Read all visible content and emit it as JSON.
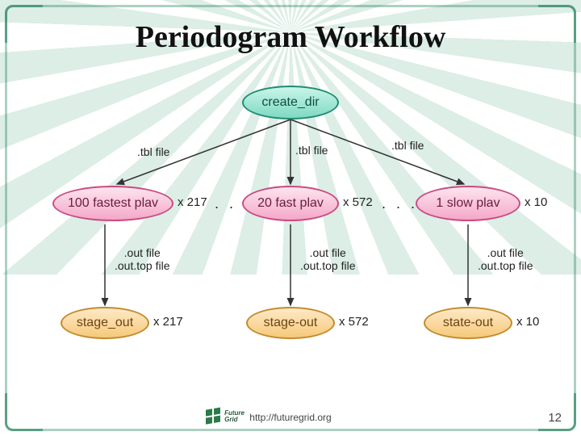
{
  "title": "Periodogram Workflow",
  "footer_url": "http://futuregrid.org",
  "page_number": "12",
  "logo_text": "Future\nGrid",
  "nodes": {
    "root": "create_dir",
    "fastest": "100 fastest plav",
    "fast": "20 fast plav",
    "slow": "1 slow plav",
    "stage_left": "stage_out",
    "stage_mid": "stage-out",
    "stage_right": "state-out"
  },
  "edge_labels": {
    "tbl_left": ".tbl file",
    "tbl_mid": ".tbl file",
    "tbl_right": ".tbl file",
    "out_left": ".out file\n.out.top file",
    "out_mid": ".out file\n.out.top file",
    "out_right": ".out file\n.out.top file"
  },
  "multipliers": {
    "fastest": "x 217",
    "fast": "x 572",
    "slow": "x 10",
    "stage_left": "x 217",
    "stage_mid": "x 572",
    "stage_right": "x 10"
  },
  "dots": ". . .",
  "diagram_structure": {
    "root": {
      "id": "create_dir",
      "type": "process",
      "children": [
        "fastest",
        "fast",
        "slow"
      ],
      "edge_label": ".tbl file"
    },
    "branches": [
      {
        "id": "fastest",
        "label": "100 fastest plav",
        "count": 217,
        "output": "stage_out",
        "output_edge": [
          ".out file",
          ".out.top file"
        ]
      },
      {
        "id": "fast",
        "label": "20 fast plav",
        "count": 572,
        "output": "stage-out",
        "output_edge": [
          ".out file",
          ".out.top file"
        ]
      },
      {
        "id": "slow",
        "label": "1 slow plav",
        "count": 10,
        "output": "state-out",
        "output_edge": [
          ".out file",
          ".out.top file"
        ]
      }
    ]
  }
}
